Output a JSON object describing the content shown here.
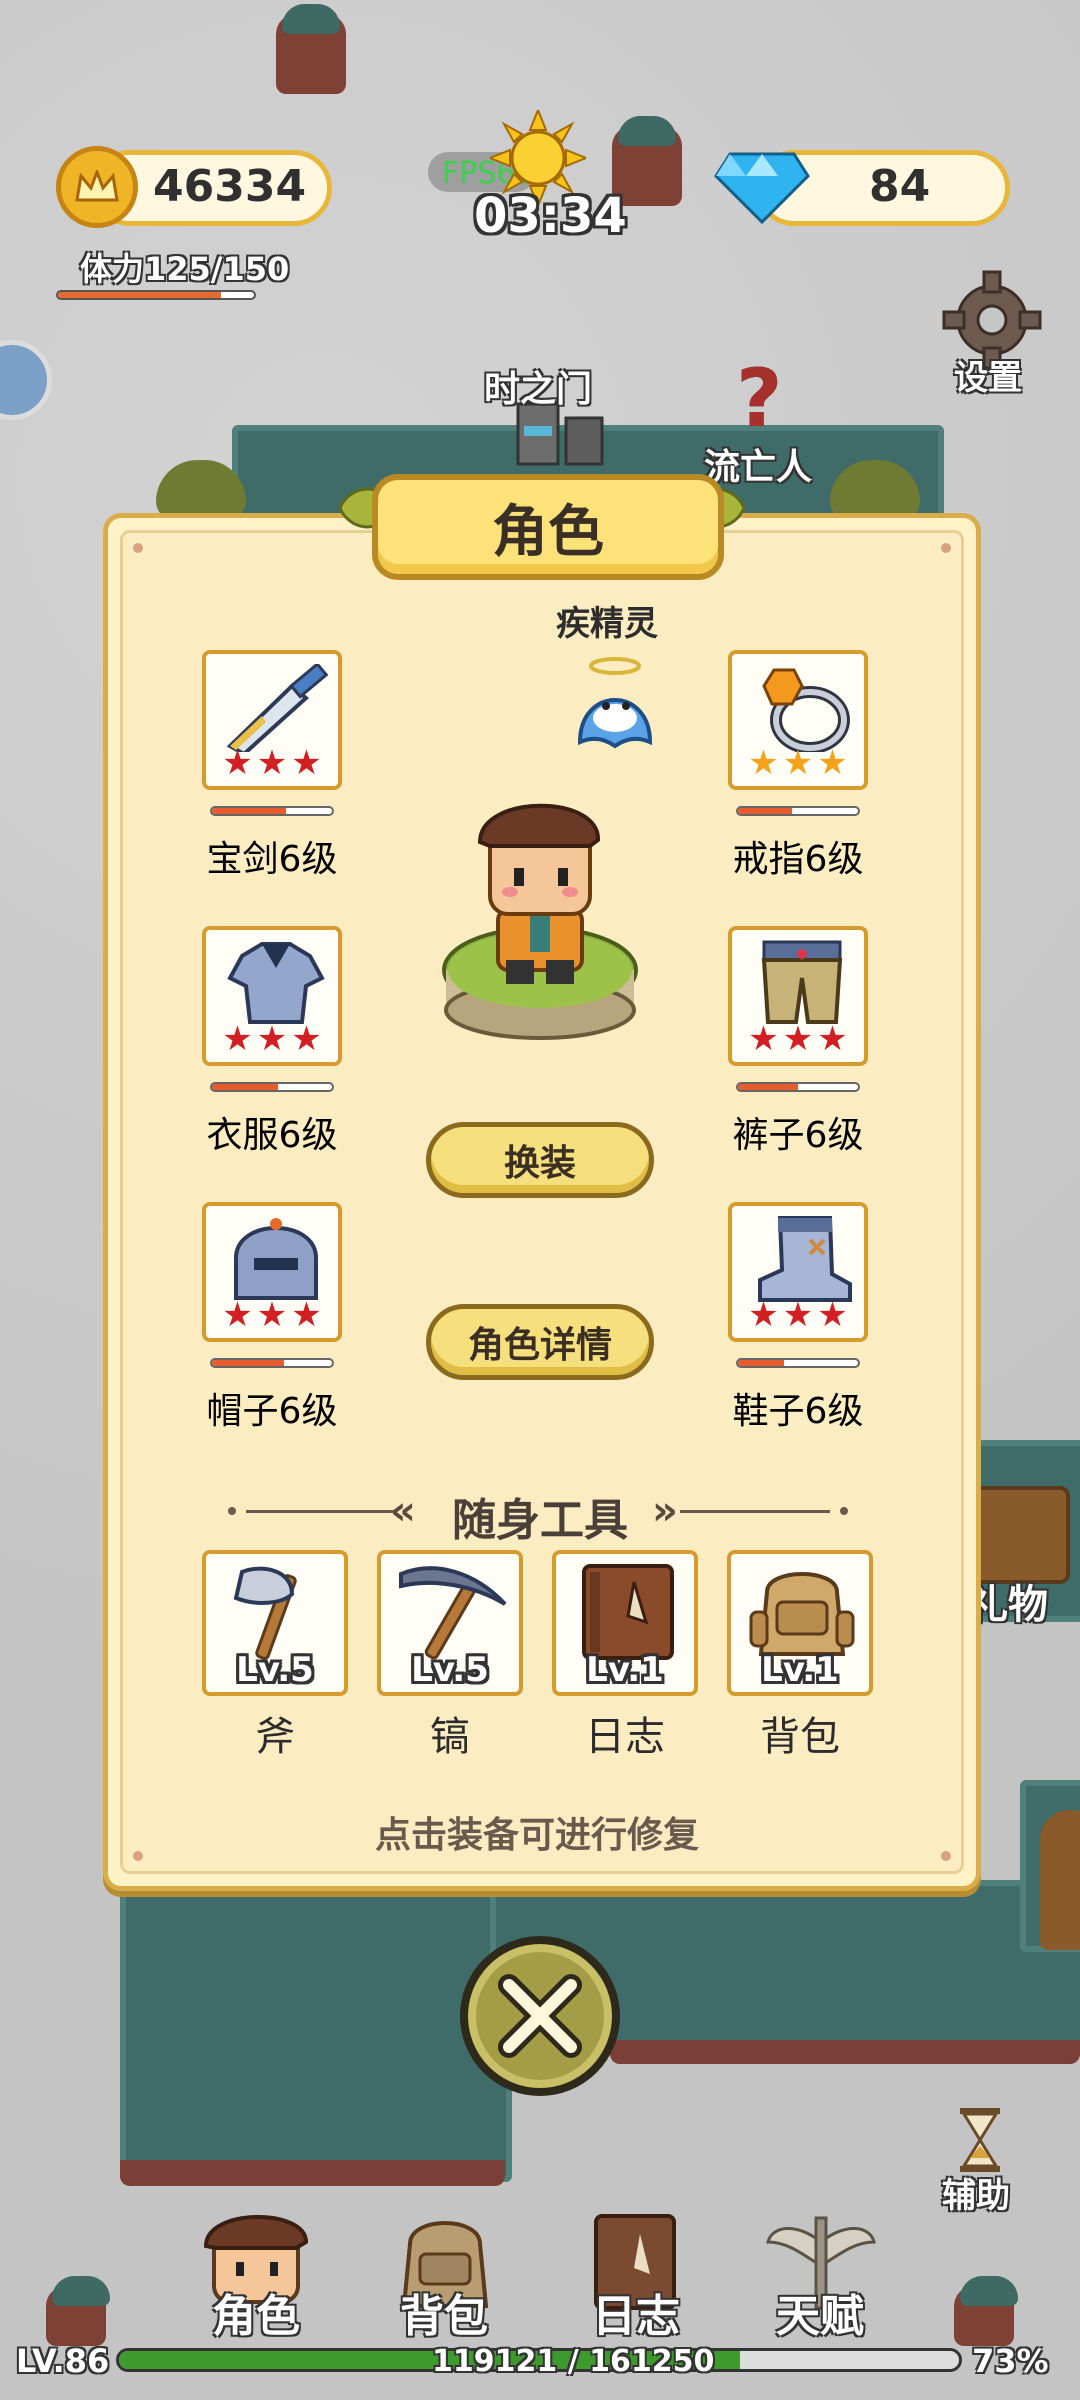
{
  "hud": {
    "coins": "46334",
    "fps": "FPS60",
    "timer": "03:34",
    "gems": "84",
    "stamina_label": "体力125/150",
    "stamina_fraction": 0.83,
    "settings_label": "设置"
  },
  "world": {
    "gate_label": "时之门",
    "question_mark": "?",
    "exile_label": "流亡人",
    "gift_label": "礼物",
    "assist_label": "辅助"
  },
  "dialog": {
    "title": "角色",
    "pet_name": "疾精灵",
    "equipment": [
      {
        "label": "宝剑6级",
        "stars": 3,
        "star_color": "red",
        "durability": 0.62
      },
      {
        "label": "戒指6级",
        "stars": 3,
        "star_color": "gold",
        "durability": 0.45
      },
      {
        "label": "衣服6级",
        "stars": 3,
        "star_color": "red",
        "durability": 0.55
      },
      {
        "label": "裤子6级",
        "stars": 3,
        "star_color": "red",
        "durability": 0.5
      },
      {
        "label": "帽子6级",
        "stars": 3,
        "star_color": "red",
        "durability": 0.6
      },
      {
        "label": "鞋子6级",
        "stars": 3,
        "star_color": "red",
        "durability": 0.38
      }
    ],
    "change_outfit_button": "换装",
    "details_button": "角色详情",
    "tools_heading": "随身工具",
    "tools": [
      {
        "name": "斧",
        "level": "Lv.5"
      },
      {
        "name": "镐",
        "level": "Lv.5"
      },
      {
        "name": "日志",
        "level": "Lv.1"
      },
      {
        "name": "背包",
        "level": "Lv.1"
      }
    ],
    "hint": "点击装备可进行修复"
  },
  "bottom_nav": {
    "items": [
      "角色",
      "背包",
      "日志",
      "天赋"
    ]
  },
  "xp": {
    "level": "LV.86",
    "progress_text": "119121 / 161250",
    "percent_text": "73%",
    "fraction": 0.7387
  },
  "colors": {
    "panel_bg": "#fbecc1",
    "panel_border": "#d9ad4a",
    "star_red": "#d11f23",
    "star_gold": "#f4a21a",
    "water": "#3f6c69",
    "xp_green": "#3f9a2e"
  }
}
